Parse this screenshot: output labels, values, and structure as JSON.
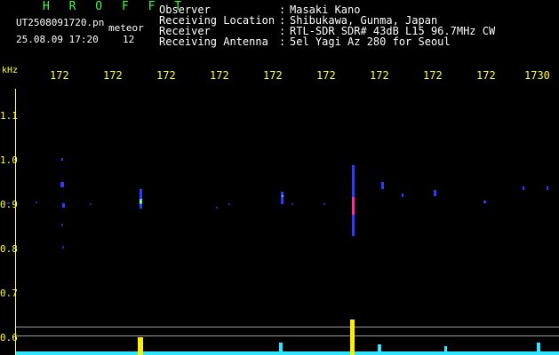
{
  "header": {
    "brand": "H R O F F T",
    "filename": "UT2508091720.pn",
    "meteor_label": "meteor",
    "timestamp": "25.08.09 17:20",
    "count": "12"
  },
  "station": {
    "rows": [
      {
        "label": "Observer",
        "value": "Masaki Kano"
      },
      {
        "label": "Receiving Location",
        "value": "Shibukawa, Gunma, Japan"
      },
      {
        "label": "Receiver",
        "value": "RTL-SDR SDR# 43dB L15 96.7MHz CW"
      },
      {
        "label": "Receiving Antenna",
        "value": "5el Yagi Az 280 for Seoul"
      }
    ],
    "separator": ":"
  },
  "axis": {
    "unit": "kHz",
    "x_ticks": [
      "172",
      "172",
      "172",
      "172",
      "172",
      "172",
      "172",
      "172",
      "172",
      "1730"
    ],
    "y_ticks": [
      "1.1",
      "1.0",
      "0.9",
      "0.8",
      "0.7",
      "0.6"
    ]
  },
  "colors": {
    "background": "#000000",
    "label": "#ffff33",
    "brand": "#3cff3c",
    "baseline": "#2ee6ff",
    "burst": "#ffee00"
  }
}
